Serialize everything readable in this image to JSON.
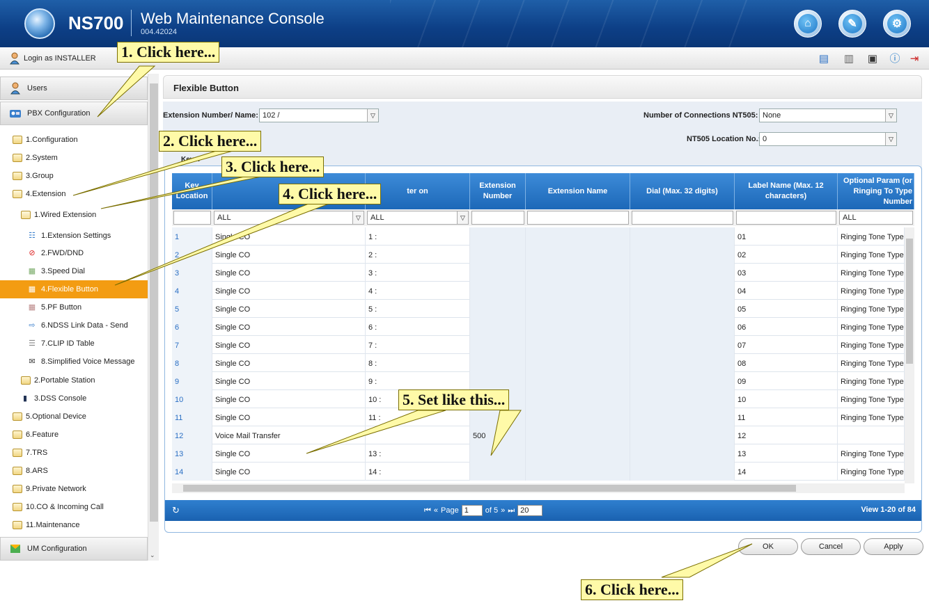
{
  "header": {
    "brand": "NS700",
    "app_title": "Web Maintenance Console",
    "version": "004.42024"
  },
  "loginbar": {
    "login_label": "Login as INSTALLER"
  },
  "sidebar": {
    "users": "Users",
    "pbx": "PBX Configuration",
    "um": "UM Configuration",
    "items": [
      {
        "label": "1.Configuration"
      },
      {
        "label": "2.System"
      },
      {
        "label": "3.Group"
      },
      {
        "label": "4.Extension"
      },
      {
        "label": "1.Wired Extension"
      },
      {
        "label": "1.Extension Settings"
      },
      {
        "label": "2.FWD/DND"
      },
      {
        "label": "3.Speed Dial"
      },
      {
        "label": "4.Flexible Button"
      },
      {
        "label": "5.PF Button"
      },
      {
        "label": "6.NDSS Link Data - Send"
      },
      {
        "label": "7.CLIP ID Table"
      },
      {
        "label": "8.Simplified Voice Message"
      },
      {
        "label": "2.Portable Station"
      },
      {
        "label": "3.DSS Console"
      },
      {
        "label": "5.Optional Device"
      },
      {
        "label": "6.Feature"
      },
      {
        "label": "7.TRS"
      },
      {
        "label": "8.ARS"
      },
      {
        "label": "9.Private Network"
      },
      {
        "label": "10.CO & Incoming Call"
      },
      {
        "label": "11.Maintenance"
      }
    ]
  },
  "panel": {
    "title": "Flexible Button",
    "ext_label": "Extension Number/ Name:",
    "ext_value": "102 /",
    "conn_label": "Number of Connections NT505:",
    "conn_value": "None",
    "loc_label": "NT505 Location No.:",
    "loc_value": "0",
    "keys_label": "Keys:"
  },
  "grid": {
    "headers": {
      "key": "Key Location",
      "type": "",
      "param": "ter on",
      "ext": "Extension Number",
      "name": "Extension Name",
      "dial": "Dial (Max. 32 digits)",
      "label": "Label Name (Max. 12 characters)",
      "opt": "Optional Param (or Ringing To Type Number"
    },
    "filter_all": "ALL",
    "rows": [
      {
        "key": "1",
        "type": "Single CO",
        "param": "1 :",
        "ext": "",
        "label": "01",
        "opt": "Ringing Tone Type"
      },
      {
        "key": "2",
        "type": "Single CO",
        "param": "2 :",
        "ext": "",
        "label": "02",
        "opt": "Ringing Tone Type"
      },
      {
        "key": "3",
        "type": "Single CO",
        "param": "3 :",
        "ext": "",
        "label": "03",
        "opt": "Ringing Tone Type"
      },
      {
        "key": "4",
        "type": "Single CO",
        "param": "4 :",
        "ext": "",
        "label": "04",
        "opt": "Ringing Tone Type"
      },
      {
        "key": "5",
        "type": "Single CO",
        "param": "5 :",
        "ext": "",
        "label": "05",
        "opt": "Ringing Tone Type"
      },
      {
        "key": "6",
        "type": "Single CO",
        "param": "6 :",
        "ext": "",
        "label": "06",
        "opt": "Ringing Tone Type"
      },
      {
        "key": "7",
        "type": "Single CO",
        "param": "7 :",
        "ext": "",
        "label": "07",
        "opt": "Ringing Tone Type"
      },
      {
        "key": "8",
        "type": "Single CO",
        "param": "8 :",
        "ext": "",
        "label": "08",
        "opt": "Ringing Tone Type"
      },
      {
        "key": "9",
        "type": "Single CO",
        "param": "9 :",
        "ext": "",
        "label": "09",
        "opt": "Ringing Tone Type"
      },
      {
        "key": "10",
        "type": "Single CO",
        "param": "10 :",
        "ext": "",
        "label": "10",
        "opt": "Ringing Tone Type"
      },
      {
        "key": "11",
        "type": "Single CO",
        "param": "11 :",
        "ext": "",
        "label": "11",
        "opt": "Ringing Tone Type"
      },
      {
        "key": "12",
        "type": "Voice Mail Transfer",
        "param": "",
        "ext": "500",
        "label": "12",
        "opt": ""
      },
      {
        "key": "13",
        "type": "Single CO",
        "param": "13 :",
        "ext": "",
        "label": "13",
        "opt": "Ringing Tone Type"
      },
      {
        "key": "14",
        "type": "Single CO",
        "param": "14 :",
        "ext": "",
        "label": "14",
        "opt": "Ringing Tone Type"
      }
    ]
  },
  "pager": {
    "page_label": "Page",
    "page_value": "1",
    "of_label": "of 5",
    "size_value": "20",
    "view_label": "View 1-20 of 84"
  },
  "buttons": {
    "ok": "OK",
    "cancel": "Cancel",
    "apply": "Apply"
  },
  "callouts": {
    "c1": "1. Click here...",
    "c2": "2. Click here...",
    "c3": "3. Click here...",
    "c4": "4. Click here...",
    "c5": "5. Set like this...",
    "c6": "6. Click here..."
  },
  "colors": {
    "header_blue": "#0d3f86",
    "grid_blue": "#1c68b8",
    "selected_orange": "#f39c12",
    "callout_yellow": "#fffaa8"
  }
}
